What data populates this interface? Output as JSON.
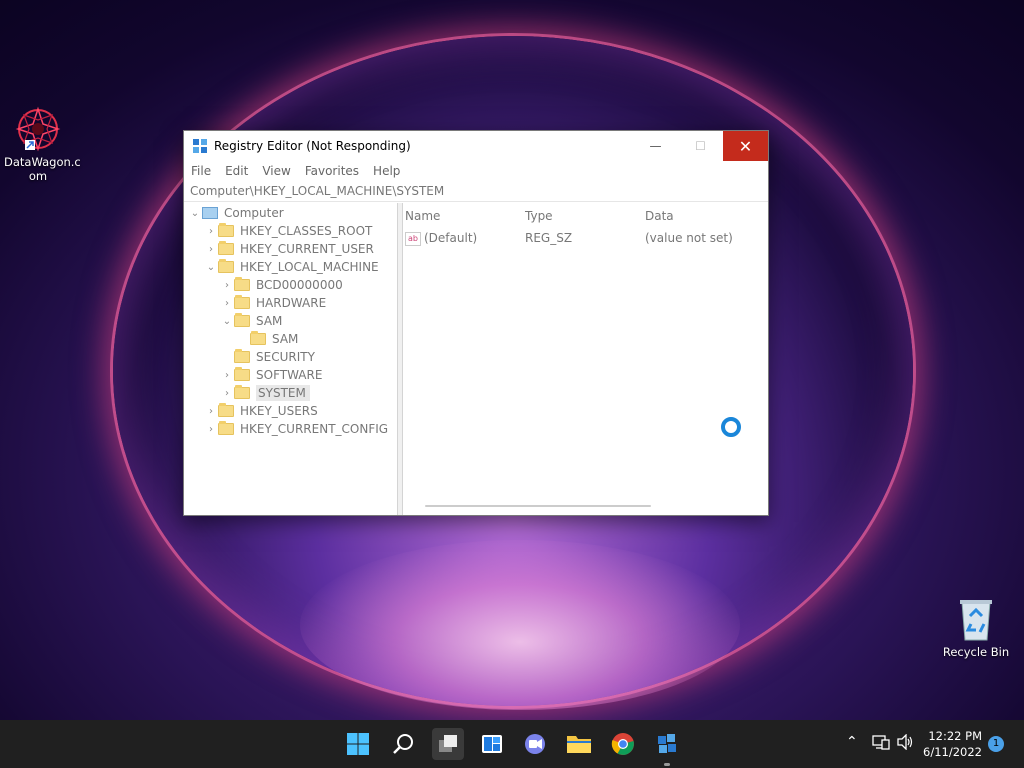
{
  "desktop": {
    "icons": [
      {
        "label": "DataWagon.c\nom"
      },
      {
        "label": "Recycle Bin"
      }
    ]
  },
  "window": {
    "title": "Registry Editor (Not Responding)",
    "menu": [
      "File",
      "Edit",
      "View",
      "Favorites",
      "Help"
    ],
    "address": "Computer\\HKEY_LOCAL_MACHINE\\SYSTEM",
    "tree": [
      {
        "label": "Computer",
        "chevron": "⌄"
      },
      {
        "label": "HKEY_CLASSES_ROOT",
        "chevron": "›"
      },
      {
        "label": "HKEY_CURRENT_USER",
        "chevron": "›"
      },
      {
        "label": "HKEY_LOCAL_MACHINE",
        "chevron": "⌄"
      },
      {
        "label": "BCD00000000",
        "chevron": "›"
      },
      {
        "label": "HARDWARE",
        "chevron": "›"
      },
      {
        "label": "SAM",
        "chevron": "⌄"
      },
      {
        "label": "SAM",
        "chevron": ""
      },
      {
        "label": "SECURITY",
        "chevron": ""
      },
      {
        "label": "SOFTWARE",
        "chevron": "›"
      },
      {
        "label": "SYSTEM",
        "chevron": "›"
      },
      {
        "label": "HKEY_USERS",
        "chevron": "›"
      },
      {
        "label": "HKEY_CURRENT_CONFIG",
        "chevron": "›"
      }
    ],
    "columns": [
      "Name",
      "Type",
      "Data"
    ],
    "rows": [
      {
        "name": "(Default)",
        "type": "REG_SZ",
        "data": "(value not set)"
      }
    ],
    "value_icon_text": "ab"
  },
  "taskbar": {
    "time": "12:22 PM",
    "date": "6/11/2022",
    "notification_count": "1"
  },
  "colors": {
    "close_button": "#c42b1c",
    "taskbar": "#202020",
    "busy_cursor": "#1a86d9"
  }
}
